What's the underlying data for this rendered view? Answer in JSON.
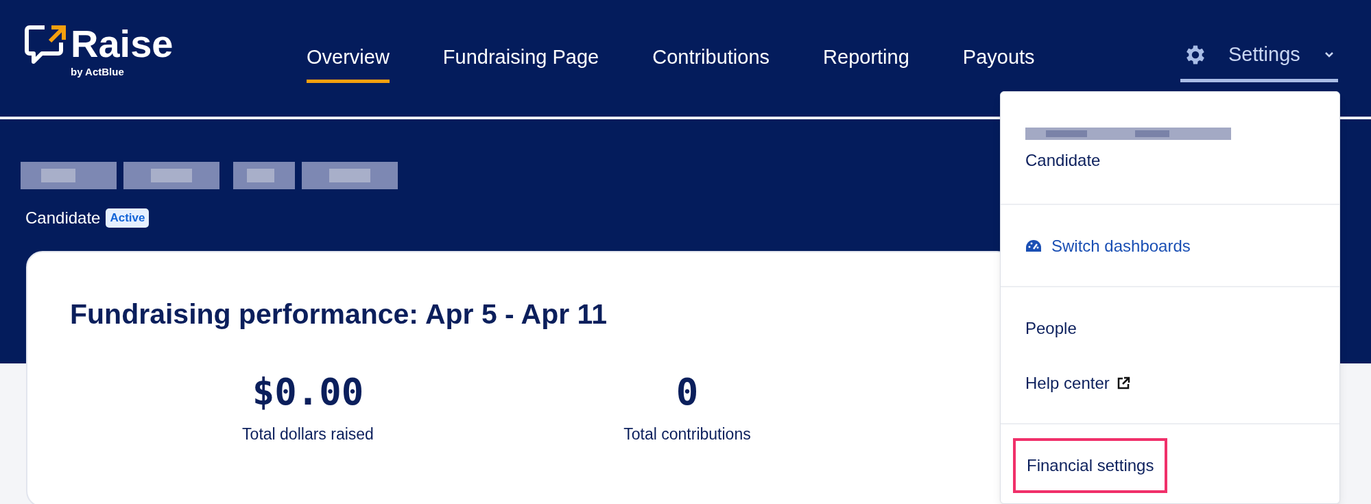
{
  "brand": {
    "name": "Raise",
    "byline": "by ActBlue"
  },
  "nav": [
    {
      "label": "Overview",
      "selected": true
    },
    {
      "label": "Fundraising Page",
      "selected": false
    },
    {
      "label": "Contributions",
      "selected": false
    },
    {
      "label": "Reporting",
      "selected": false
    },
    {
      "label": "Payouts",
      "selected": false
    }
  ],
  "settings_menu": {
    "label": "Settings",
    "expanded": true
  },
  "account": {
    "role": "Candidate",
    "status": "Active"
  },
  "performance": {
    "title": "Fundraising performance: Apr 5 - Apr 11",
    "stats": [
      {
        "value": "$0.00",
        "label": "Total dollars raised"
      },
      {
        "value": "0",
        "label": "Total contributions"
      }
    ]
  },
  "dropdown": {
    "account_role": "Candidate",
    "sections": [
      [
        {
          "kind": "link",
          "label": "Switch dashboards",
          "highlighted": false
        }
      ],
      [
        {
          "kind": "plain",
          "label": "People",
          "highlighted": false
        },
        {
          "kind": "external",
          "label": "Help center",
          "highlighted": false
        }
      ],
      [
        {
          "kind": "plain",
          "label": "Financial settings",
          "highlighted": true
        }
      ]
    ]
  }
}
